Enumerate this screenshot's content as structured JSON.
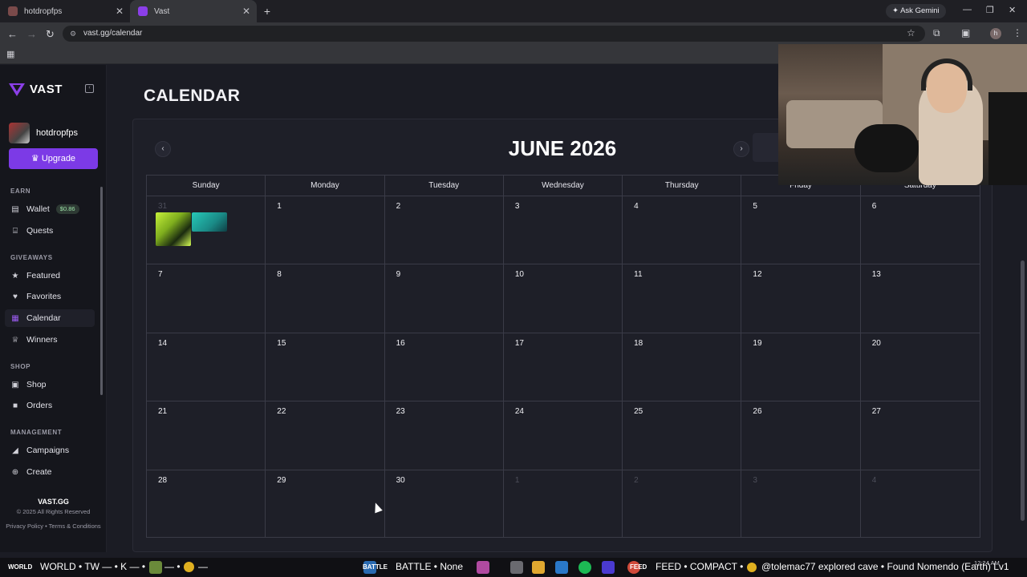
{
  "browser": {
    "tabs": [
      {
        "label": "hotdropfps",
        "active": false
      },
      {
        "label": "Vast",
        "active": true
      }
    ],
    "ask_gemini": "Ask Gemini",
    "url": "vast.gg/calendar",
    "profile_initial": "h"
  },
  "sidebar": {
    "logo": "VAST",
    "username": "hotdropfps",
    "upgrade_label": "Upgrade",
    "sections": {
      "earn": "EARN",
      "giveaways": "GIVEAWAYS",
      "shop": "SHOP",
      "management": "MANAGEMENT"
    },
    "items": {
      "wallet": "Wallet",
      "wallet_balance": "$0.86",
      "quests": "Quests",
      "featured": "Featured",
      "favorites": "Favorites",
      "calendar": "Calendar",
      "winners": "Winners",
      "shop": "Shop",
      "orders": "Orders",
      "campaigns": "Campaigns",
      "create": "Create"
    },
    "footer": {
      "brand": "VAST.GG",
      "copyright": "© 2025 All Rights Reserved",
      "privacy": "Privacy Policy",
      "terms": "Terms & Conditions"
    }
  },
  "main": {
    "title": "CALENDAR",
    "month_title": "JUNE 2026",
    "weekdays": [
      "Sunday",
      "Monday",
      "Tuesday",
      "Wednesday",
      "Thursday",
      "Friday",
      "Saturday"
    ],
    "weeks": [
      [
        "31",
        "1",
        "2",
        "3",
        "4",
        "5",
        "6"
      ],
      [
        "7",
        "8",
        "9",
        "10",
        "11",
        "12",
        "13"
      ],
      [
        "14",
        "15",
        "16",
        "17",
        "18",
        "19",
        "20"
      ],
      [
        "21",
        "22",
        "23",
        "24",
        "25",
        "26",
        "27"
      ],
      [
        "28",
        "29",
        "30",
        "1",
        "2",
        "3",
        "4"
      ]
    ]
  },
  "taskbar": {
    "world_small": "WORLD",
    "world": "WORLD • TW — • K — •",
    "world_tail": "— •",
    "world_end": "—",
    "battle_small": "BATTLE",
    "battle": "BATTLE • None",
    "feed_small": "FEED",
    "feed": "FEED • COMPACT •",
    "feed_msg": "@tolemac77 explored cave • Found Nomendo (Earth) Lv1",
    "clock": "12:24 AM"
  }
}
